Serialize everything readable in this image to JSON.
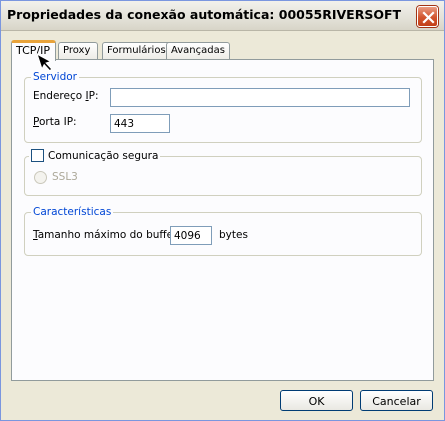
{
  "window": {
    "title": "Propriedades da conexão automática: 00055RIVERSOFT"
  },
  "tabs": [
    {
      "label": "TCP/IP",
      "active": true
    },
    {
      "label": "Proxy",
      "active": false
    },
    {
      "label": "Formulários",
      "active": false
    },
    {
      "label": "Avançadas",
      "active": false
    }
  ],
  "servidor": {
    "legend": "Servidor",
    "address_label_pre": "Endereço ",
    "address_label_key": "I",
    "address_label_post": "P:",
    "address_value": "",
    "port_label_key": "P",
    "port_label_post": "orta IP:",
    "port_value": "443"
  },
  "secure": {
    "checkbox_label": "Comunicação segura",
    "checked": false,
    "ssl_label": "SSL3"
  },
  "caracteristicas": {
    "legend": "Características",
    "buffer_label_key": "T",
    "buffer_label_post": "amanho máximo do buffer:",
    "buffer_value": "4096",
    "buffer_unit": "bytes"
  },
  "buttons": {
    "ok": "OK",
    "cancel": "Cancelar"
  },
  "colors": {
    "accent": "#0046D5",
    "tab_highlight": "#E8A33A",
    "close": "#D2552E"
  },
  "icons": [
    "close-icon",
    "mouse-cursor-icon"
  ]
}
